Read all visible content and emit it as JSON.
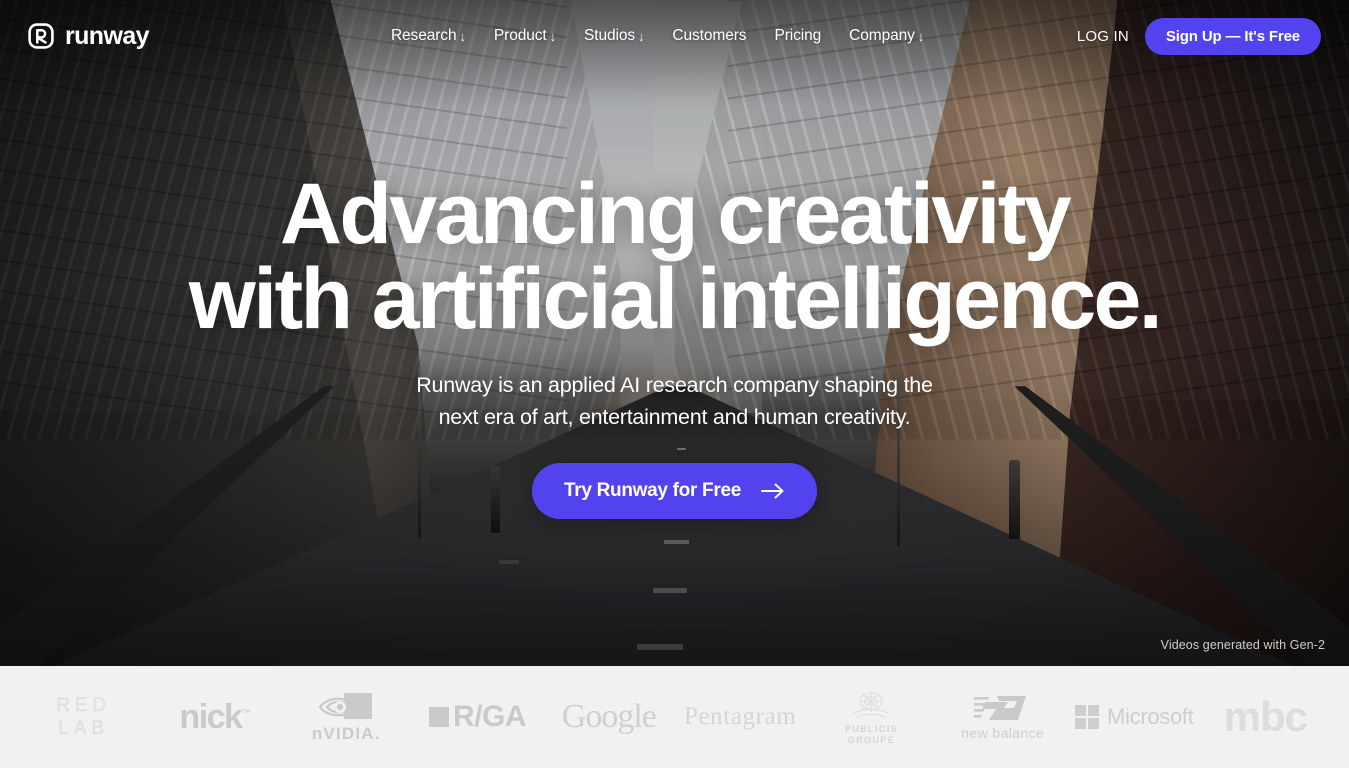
{
  "brand": {
    "name": "runway",
    "mark_icon": "runway-logo-icon"
  },
  "nav": {
    "links": [
      {
        "label": "Research",
        "caret": "↓",
        "has_dropdown": true
      },
      {
        "label": "Product",
        "caret": "↓",
        "has_dropdown": true
      },
      {
        "label": "Studios",
        "caret": "↓",
        "has_dropdown": true
      },
      {
        "label": "Customers",
        "caret": "",
        "has_dropdown": false
      },
      {
        "label": "Pricing",
        "caret": "",
        "has_dropdown": false
      },
      {
        "label": "Company",
        "caret": "↓",
        "has_dropdown": true
      }
    ],
    "login_label": "LOG IN",
    "signup_label": "Sign Up — It's Free"
  },
  "hero": {
    "headline_line1": "Advancing creativity",
    "headline_line2": "with artificial intelligence.",
    "subhead_line1": "Runway is an applied AI research company shaping the",
    "subhead_line2": "next era of art, entertainment and human creativity.",
    "cta_label": "Try Runway for Free",
    "cta_arrow_icon": "arrow-right-icon",
    "credit": "Videos generated with Gen-2",
    "background_description": "Dark empty city street canyon at dusk with buildings on both sides"
  },
  "logo_bar": {
    "background": "#F1F1F1",
    "logos": [
      {
        "name": "red-lab",
        "line1": "RED",
        "line2": "LAB"
      },
      {
        "name": "nickelodeon",
        "text": "nick",
        "mark": "™"
      },
      {
        "name": "nvidia",
        "text": "nVIDIA."
      },
      {
        "name": "rga",
        "text": "R/GA"
      },
      {
        "name": "google",
        "text": "Google"
      },
      {
        "name": "pentagram",
        "text": "Pentagram"
      },
      {
        "name": "publicis-groupe",
        "line1": "PUBLICIS",
        "line2": "GROUPE"
      },
      {
        "name": "new-balance",
        "text": "new balance"
      },
      {
        "name": "microsoft",
        "text": "Microsoft"
      },
      {
        "name": "mbc",
        "text": "mbc"
      }
    ]
  },
  "colors": {
    "accent": "#5243EE",
    "hero_text": "#FFFFFF",
    "logo_bar_bg": "#F1F1F1",
    "logo_gray": "#CACBCD"
  }
}
